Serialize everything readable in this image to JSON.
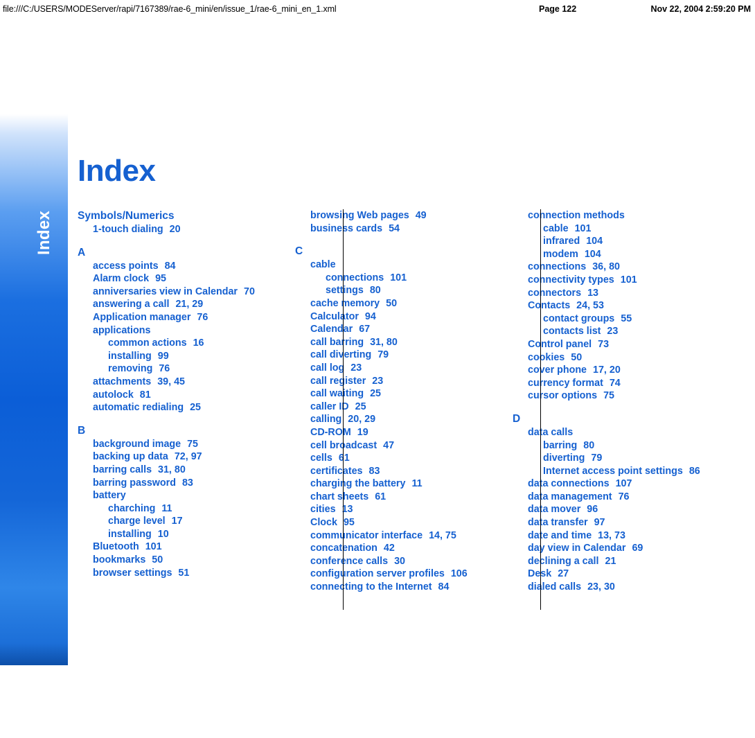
{
  "print_header": {
    "url": "file:///C:/USERS/MODEServer/rapi/7167389/rae-6_mini/en/issue_1/rae-6_mini_en_1.xml",
    "page_label": "Page 122",
    "timestamp": "Nov 22, 2004 2:59:20 PM"
  },
  "side_tab": {
    "label": "Index",
    "page_number": "122",
    "accent_color": "#0b5ed7"
  },
  "page": {
    "title": "Index",
    "title_color": "#1560d0",
    "text_color": "#1560d0"
  },
  "columns": [
    {
      "id": "column-1",
      "blocks": [
        {
          "letter": "Symbols/Numerics",
          "entries": [
            {
              "level": 1,
              "text": "1-touch dialing",
              "pages": "20"
            }
          ]
        },
        {
          "letter": "A",
          "entries": [
            {
              "level": 1,
              "text": "access points",
              "pages": "84"
            },
            {
              "level": 1,
              "text": "Alarm clock",
              "pages": "95"
            },
            {
              "level": 1,
              "text": "anniversaries view in Calendar",
              "pages": "70"
            },
            {
              "level": 1,
              "text": "answering a call",
              "pages": "21, 29"
            },
            {
              "level": 1,
              "text": "Application manager",
              "pages": "76"
            },
            {
              "level": 1,
              "text": "applications",
              "pages": ""
            },
            {
              "level": 2,
              "text": "common actions",
              "pages": "16"
            },
            {
              "level": 2,
              "text": "installing",
              "pages": "99"
            },
            {
              "level": 2,
              "text": "removing",
              "pages": "76"
            },
            {
              "level": 1,
              "text": "attachments",
              "pages": "39, 45"
            },
            {
              "level": 1,
              "text": "autolock",
              "pages": "81"
            },
            {
              "level": 1,
              "text": "automatic redialing",
              "pages": "25"
            }
          ]
        },
        {
          "letter": "B",
          "entries": [
            {
              "level": 1,
              "text": "background image",
              "pages": "75"
            },
            {
              "level": 1,
              "text": "backing up data",
              "pages": "72, 97"
            },
            {
              "level": 1,
              "text": "barring calls",
              "pages": "31, 80"
            },
            {
              "level": 1,
              "text": "barring password",
              "pages": "83"
            },
            {
              "level": 1,
              "text": "battery",
              "pages": ""
            },
            {
              "level": 2,
              "text": "charching",
              "pages": "11"
            },
            {
              "level": 2,
              "text": "charge level",
              "pages": "17"
            },
            {
              "level": 2,
              "text": "installing",
              "pages": "10"
            },
            {
              "level": 1,
              "text": "Bluetooth",
              "pages": "101"
            },
            {
              "level": 1,
              "text": "bookmarks",
              "pages": "50"
            },
            {
              "level": 1,
              "text": "browser settings",
              "pages": "51"
            }
          ]
        }
      ]
    },
    {
      "id": "column-2",
      "blocks": [
        {
          "letter": "",
          "entries": [
            {
              "level": 1,
              "text": "browsing Web pages",
              "pages": "49"
            },
            {
              "level": 1,
              "text": "business cards",
              "pages": "54"
            }
          ]
        },
        {
          "letter": "C",
          "entries": [
            {
              "level": 1,
              "text": "cable",
              "pages": ""
            },
            {
              "level": 2,
              "text": "connections",
              "pages": "101"
            },
            {
              "level": 2,
              "text": "settings",
              "pages": "80"
            },
            {
              "level": 1,
              "text": "cache memory",
              "pages": "50"
            },
            {
              "level": 1,
              "text": "Calculator",
              "pages": "94"
            },
            {
              "level": 1,
              "text": "Calendar",
              "pages": "67"
            },
            {
              "level": 1,
              "text": "call barring",
              "pages": "31, 80"
            },
            {
              "level": 1,
              "text": "call diverting",
              "pages": "79"
            },
            {
              "level": 1,
              "text": "call log",
              "pages": "23"
            },
            {
              "level": 1,
              "text": "call register",
              "pages": "23"
            },
            {
              "level": 1,
              "text": "call waiting",
              "pages": "25"
            },
            {
              "level": 1,
              "text": "caller ID",
              "pages": "25"
            },
            {
              "level": 1,
              "text": "calling",
              "pages": "20, 29"
            },
            {
              "level": 1,
              "text": "CD-ROM",
              "pages": "19"
            },
            {
              "level": 1,
              "text": "cell broadcast",
              "pages": "47"
            },
            {
              "level": 1,
              "text": "cells",
              "pages": "61"
            },
            {
              "level": 1,
              "text": "certificates",
              "pages": "83"
            },
            {
              "level": 1,
              "text": "charging the battery",
              "pages": "11"
            },
            {
              "level": 1,
              "text": "chart sheets",
              "pages": "61"
            },
            {
              "level": 1,
              "text": "cities",
              "pages": "13"
            },
            {
              "level": 1,
              "text": "Clock",
              "pages": "95"
            },
            {
              "level": 1,
              "text": "communicator interface",
              "pages": "14, 75"
            },
            {
              "level": 1,
              "text": "concatenation",
              "pages": "42"
            },
            {
              "level": 1,
              "text": "conference calls",
              "pages": "30"
            },
            {
              "level": 1,
              "text": "configuration server profiles",
              "pages": "106"
            },
            {
              "level": 1,
              "text": "connecting to the Internet",
              "pages": "84"
            }
          ]
        }
      ]
    },
    {
      "id": "column-3",
      "blocks": [
        {
          "letter": "",
          "entries": [
            {
              "level": 1,
              "text": "connection methods",
              "pages": ""
            },
            {
              "level": 2,
              "text": "cable",
              "pages": "101"
            },
            {
              "level": 2,
              "text": "infrared",
              "pages": "104"
            },
            {
              "level": 2,
              "text": "modem",
              "pages": "104"
            },
            {
              "level": 1,
              "text": "connections",
              "pages": "36, 80"
            },
            {
              "level": 1,
              "text": "connectivity types",
              "pages": "101"
            },
            {
              "level": 1,
              "text": "connectors",
              "pages": "13"
            },
            {
              "level": 1,
              "text": "Contacts",
              "pages": "24, 53"
            },
            {
              "level": 2,
              "text": "contact groups",
              "pages": "55"
            },
            {
              "level": 2,
              "text": "contacts list",
              "pages": "23"
            },
            {
              "level": 1,
              "text": "Control panel",
              "pages": "73"
            },
            {
              "level": 1,
              "text": "cookies",
              "pages": "50"
            },
            {
              "level": 1,
              "text": "cover phone",
              "pages": "17, 20"
            },
            {
              "level": 1,
              "text": "currency format",
              "pages": "74"
            },
            {
              "level": 1,
              "text": "cursor options",
              "pages": "75"
            }
          ]
        },
        {
          "letter": "D",
          "entries": [
            {
              "level": 1,
              "text": "data calls",
              "pages": ""
            },
            {
              "level": 2,
              "text": "barring",
              "pages": "80"
            },
            {
              "level": 2,
              "text": "diverting",
              "pages": "79"
            },
            {
              "level": 2,
              "text": "Internet access point settings",
              "pages": "86"
            },
            {
              "level": 1,
              "text": "data connections",
              "pages": "107"
            },
            {
              "level": 1,
              "text": "data management",
              "pages": "76"
            },
            {
              "level": 1,
              "text": "data mover",
              "pages": "96"
            },
            {
              "level": 1,
              "text": "data transfer",
              "pages": "97"
            },
            {
              "level": 1,
              "text": "date and time",
              "pages": "13, 73"
            },
            {
              "level": 1,
              "text": "day view in Calendar",
              "pages": "69"
            },
            {
              "level": 1,
              "text": "declining a call",
              "pages": "21"
            },
            {
              "level": 1,
              "text": "Desk",
              "pages": "27"
            },
            {
              "level": 1,
              "text": "dialed calls",
              "pages": "23, 30"
            }
          ]
        }
      ]
    }
  ]
}
